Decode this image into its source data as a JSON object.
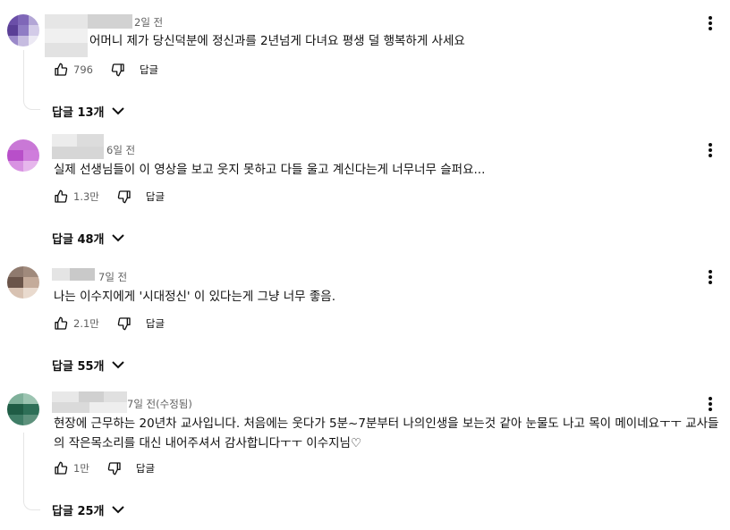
{
  "comments": [
    {
      "time": "2일 전",
      "text": "어머니 제가 당신덕분에 정신과를 2년넘게 다녀요 평생 덜 행복하게 사세요",
      "likes": "796",
      "reply_label": "답글",
      "replies_label": "답글 13개"
    },
    {
      "time": "6일 전",
      "text": "실제 선생님들이 이 영상을 보고 웃지 못하고 다들 울고 계신다는게 너무너무 슬퍼요...",
      "likes": "1.3만",
      "reply_label": "답글",
      "replies_label": "답글 48개"
    },
    {
      "time": "7일 전",
      "text": "나는 이수지에게 '시대정신' 이 있다는게 그냥 너무 좋음.",
      "likes": "2.1만",
      "reply_label": "답글",
      "replies_label": "답글 55개"
    },
    {
      "time": "7일 전(수정됨)",
      "text": "현장에 근무하는 20년차 교사입니다. 처음에는 웃다가 5분~7분부터 나의인생을 보는것 같아 눈물도 나고 목이 메이네요ㅜㅜ 교사들의 작은목소리를 대신 내어주셔서 감사합니다ㅜㅜ 이수지님♡",
      "likes": "1만",
      "reply_label": "답글",
      "replies_label": "답글 25개"
    }
  ],
  "icons": {
    "like": "thumbs-up-icon",
    "dislike": "thumbs-down-icon",
    "more": "more-vert-icon",
    "expand": "chevron-down-icon"
  }
}
